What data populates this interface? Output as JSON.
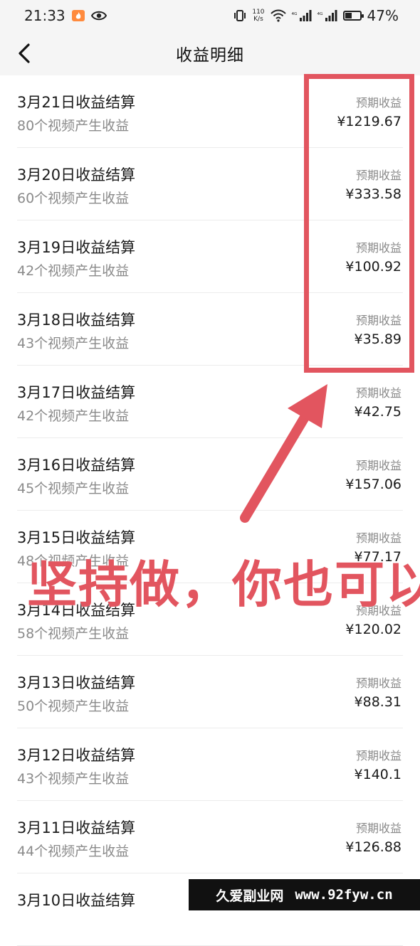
{
  "status_bar": {
    "time": "21:33",
    "net_speed_value": "110",
    "net_speed_unit": "K/s",
    "signal_1": "⁴ᴳ",
    "signal_2": "⁴ᴳ",
    "battery": "47%",
    "battery_level": 0.47
  },
  "header": {
    "title": "收益明细"
  },
  "rows": [
    {
      "title": "3月21日收益结算",
      "subtitle": "80个视频产生收益",
      "label": "预期收益",
      "amount": "¥1219.67"
    },
    {
      "title": "3月20日收益结算",
      "subtitle": "60个视频产生收益",
      "label": "预期收益",
      "amount": "¥333.58"
    },
    {
      "title": "3月19日收益结算",
      "subtitle": "42个视频产生收益",
      "label": "预期收益",
      "amount": "¥100.92"
    },
    {
      "title": "3月18日收益结算",
      "subtitle": "43个视频产生收益",
      "label": "预期收益",
      "amount": "¥35.89"
    },
    {
      "title": "3月17日收益结算",
      "subtitle": "42个视频产生收益",
      "label": "预期收益",
      "amount": "¥42.75"
    },
    {
      "title": "3月16日收益结算",
      "subtitle": "45个视频产生收益",
      "label": "预期收益",
      "amount": "¥157.06"
    },
    {
      "title": "3月15日收益结算",
      "subtitle": "48个视频产生收益",
      "label": "预期收益",
      "amount": "¥77.17"
    },
    {
      "title": "3月14日收益结算",
      "subtitle": "58个视频产生收益",
      "label": "预期收益",
      "amount": "¥120.02"
    },
    {
      "title": "3月13日收益结算",
      "subtitle": "50个视频产生收益",
      "label": "预期收益",
      "amount": "¥88.31"
    },
    {
      "title": "3月12日收益结算",
      "subtitle": "43个视频产生收益",
      "label": "预期收益",
      "amount": "¥140.1"
    },
    {
      "title": "3月11日收益结算",
      "subtitle": "44个视频产生收益",
      "label": "预期收益",
      "amount": "¥126.88"
    },
    {
      "title": "3月10日收益结算",
      "subtitle": "",
      "label": "",
      "amount": ""
    }
  ],
  "overlay": {
    "text": "坚持做，你也可以",
    "color": "#e2555f"
  },
  "watermark": {
    "brand": "久爱副业网",
    "site": "www.92fyw.cn"
  }
}
